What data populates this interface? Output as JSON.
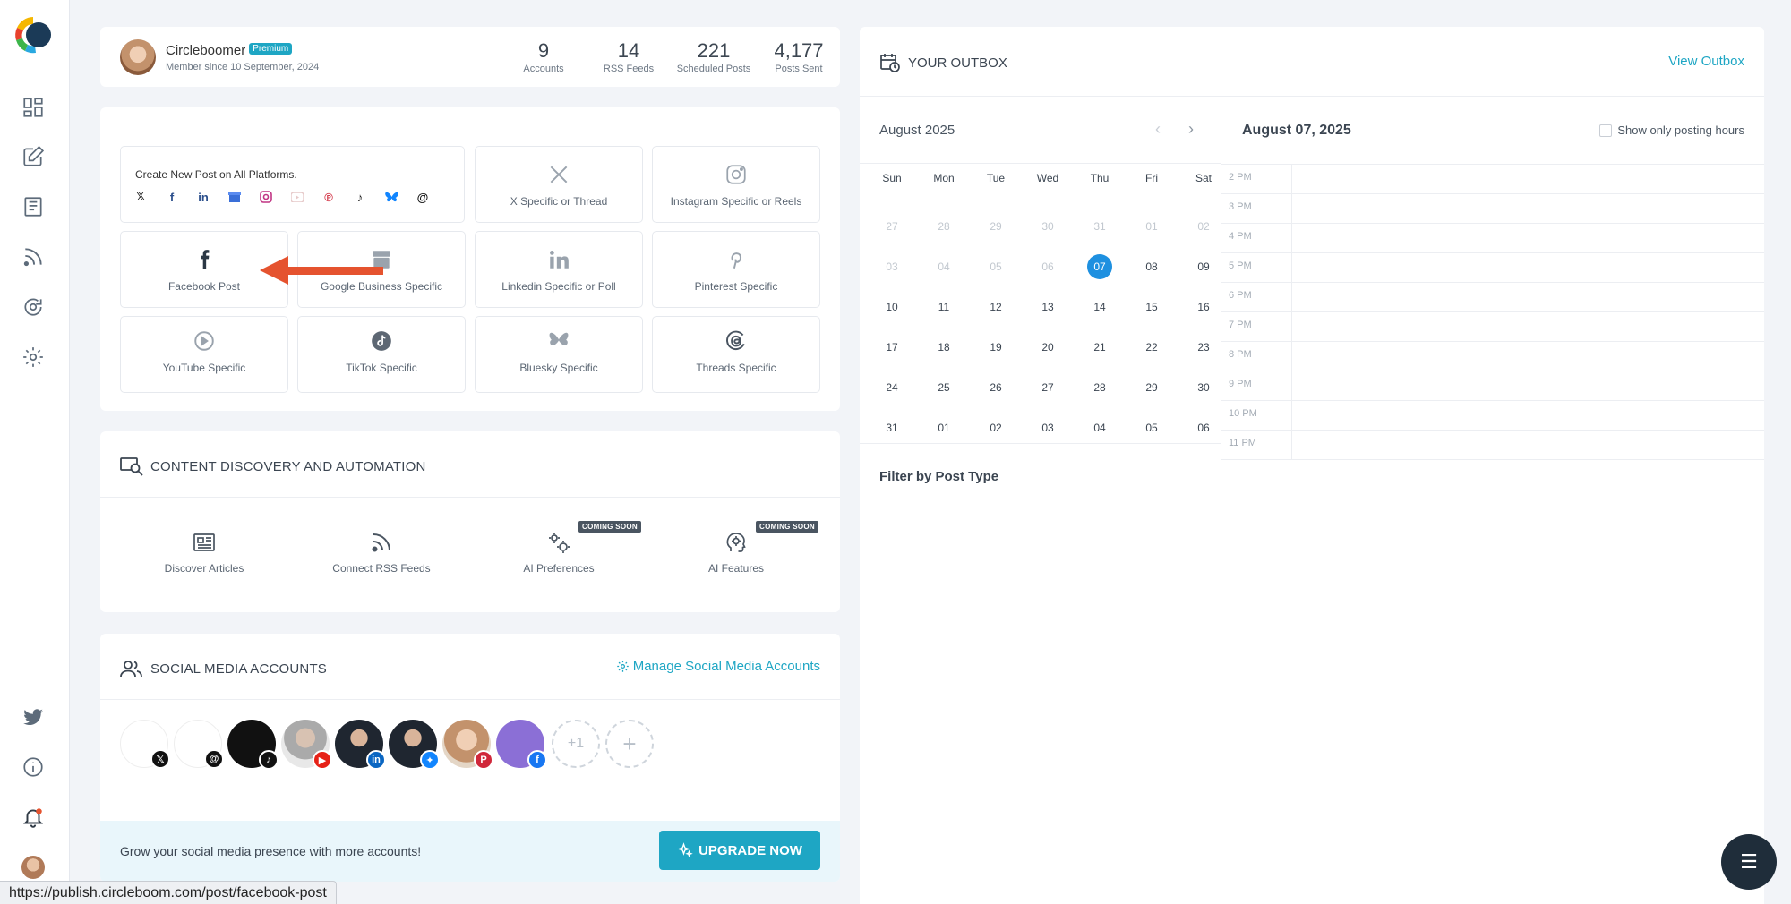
{
  "profile": {
    "name": "Circleboomer",
    "badge": "Premium",
    "since": "Member since 10 September, 2024",
    "stats": [
      {
        "num": "9",
        "label": "Accounts"
      },
      {
        "num": "14",
        "label": "RSS Feeds"
      },
      {
        "num": "221",
        "label": "Scheduled Posts"
      },
      {
        "num": "4,177",
        "label": "Posts Sent"
      }
    ]
  },
  "create": {
    "all_title": "Create New Post on All Platforms.",
    "tiles": [
      {
        "label": "X Specific or Thread",
        "icon": "x-icon"
      },
      {
        "label": "Instagram Specific or Reels",
        "icon": "instagram-icon"
      },
      {
        "label": "Facebook Post",
        "icon": "facebook-icon"
      },
      {
        "label": "Google Business Specific",
        "icon": "google-business-icon"
      },
      {
        "label": "Linkedin Specific or Poll",
        "icon": "linkedin-icon"
      },
      {
        "label": "Pinterest Specific",
        "icon": "pinterest-icon"
      },
      {
        "label": "YouTube Specific",
        "icon": "youtube-icon"
      },
      {
        "label": "TikTok Specific",
        "icon": "tiktok-icon"
      },
      {
        "label": "Bluesky Specific",
        "icon": "bluesky-icon"
      },
      {
        "label": "Threads Specific",
        "icon": "threads-icon"
      }
    ]
  },
  "discovery": {
    "title": "CONTENT DISCOVERY AND AUTOMATION",
    "items": [
      {
        "label": "Discover Articles"
      },
      {
        "label": "Connect RSS Feeds"
      },
      {
        "label": "AI Preferences",
        "badge": "COMING SOON"
      },
      {
        "label": "AI Features",
        "badge": "COMING SOON"
      }
    ]
  },
  "social": {
    "title": "SOCIAL MEDIA ACCOUNTS",
    "manage": "Manage Social Media Accounts",
    "more": "+1",
    "add": "+",
    "upgrade_text": "Grow your social media presence with more accounts!",
    "upgrade_btn": "UPGRADE NOW"
  },
  "outbox": {
    "title": "YOUR OUTBOX",
    "view": "View Outbox",
    "month": "August 2025",
    "dow": [
      "Sun",
      "Mon",
      "Tue",
      "Wed",
      "Thu",
      "Fri",
      "Sat"
    ],
    "weeks": [
      [
        "27",
        "28",
        "29",
        "30",
        "31",
        "01",
        "02"
      ],
      [
        "03",
        "04",
        "05",
        "06",
        "07",
        "08",
        "09"
      ],
      [
        "10",
        "11",
        "12",
        "13",
        "14",
        "15",
        "16"
      ],
      [
        "17",
        "18",
        "19",
        "20",
        "21",
        "22",
        "23"
      ],
      [
        "24",
        "25",
        "26",
        "27",
        "28",
        "29",
        "30"
      ],
      [
        "31",
        "01",
        "02",
        "03",
        "04",
        "05",
        "06"
      ]
    ],
    "selected": "07",
    "filter": "Filter by Post Type",
    "day_title": "August 07, 2025",
    "show_hours": "Show only posting hours",
    "hours": [
      "2 PM",
      "3 PM",
      "4 PM",
      "5 PM",
      "6 PM",
      "7 PM",
      "8 PM",
      "9 PM",
      "10 PM",
      "11 PM"
    ]
  },
  "status_url": "https://publish.circleboom.com/post/facebook-post",
  "colors": {
    "accent": "#1ea6c4",
    "selected_day": "#1e90e0",
    "arrow": "#e5532f"
  }
}
